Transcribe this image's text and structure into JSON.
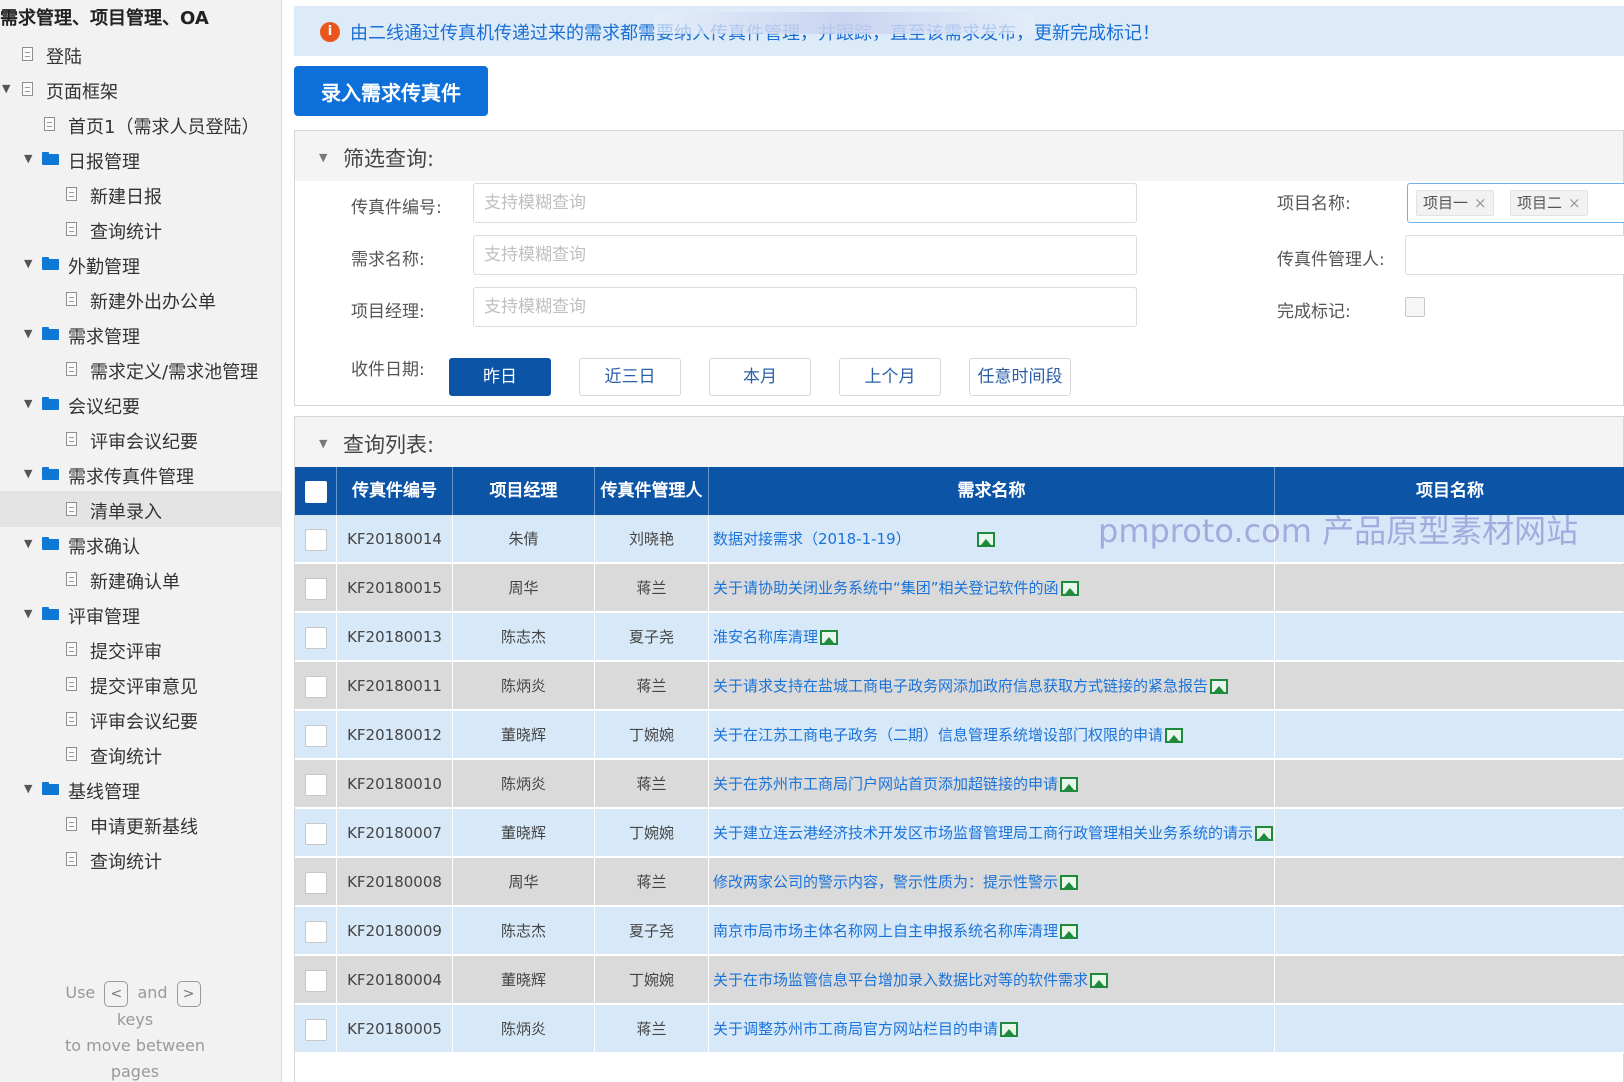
{
  "app": {
    "title": "需求管理、项目管理、OA"
  },
  "sidebar": {
    "items": [
      {
        "label": "登陆",
        "level": 0,
        "type": "page",
        "caret": false,
        "selected": false
      },
      {
        "label": "页面框架",
        "level": 0,
        "type": "page",
        "caret": true,
        "selected": false
      },
      {
        "label": "首页1（需求人员登陆）",
        "level": 1,
        "type": "page",
        "caret": false,
        "selected": false
      },
      {
        "label": "日报管理",
        "level": 1,
        "type": "folder",
        "caret": true,
        "selected": false
      },
      {
        "label": "新建日报",
        "level": 2,
        "type": "page",
        "caret": false,
        "selected": false
      },
      {
        "label": "查询统计",
        "level": 2,
        "type": "page",
        "caret": false,
        "selected": false
      },
      {
        "label": "外勤管理",
        "level": 1,
        "type": "folder",
        "caret": true,
        "selected": false
      },
      {
        "label": "新建外出办公单",
        "level": 2,
        "type": "page",
        "caret": false,
        "selected": false
      },
      {
        "label": "需求管理",
        "level": 1,
        "type": "folder",
        "caret": true,
        "selected": false
      },
      {
        "label": "需求定义/需求池管理",
        "level": 2,
        "type": "page",
        "caret": false,
        "selected": false
      },
      {
        "label": "会议纪要",
        "level": 1,
        "type": "folder",
        "caret": true,
        "selected": false
      },
      {
        "label": "评审会议纪要",
        "level": 2,
        "type": "page",
        "caret": false,
        "selected": false
      },
      {
        "label": "需求传真件管理",
        "level": 1,
        "type": "folder",
        "caret": true,
        "selected": false
      },
      {
        "label": "清单录入",
        "level": 2,
        "type": "page",
        "caret": false,
        "selected": true
      },
      {
        "label": "需求确认",
        "level": 1,
        "type": "folder",
        "caret": true,
        "selected": false
      },
      {
        "label": "新建确认单",
        "level": 2,
        "type": "page",
        "caret": false,
        "selected": false
      },
      {
        "label": "评审管理",
        "level": 1,
        "type": "folder",
        "caret": true,
        "selected": false
      },
      {
        "label": "提交评审",
        "level": 2,
        "type": "page",
        "caret": false,
        "selected": false
      },
      {
        "label": "提交评审意见",
        "level": 2,
        "type": "page",
        "caret": false,
        "selected": false
      },
      {
        "label": "评审会议纪要",
        "level": 2,
        "type": "page",
        "caret": false,
        "selected": false
      },
      {
        "label": "查询统计",
        "level": 2,
        "type": "page",
        "caret": false,
        "selected": false
      },
      {
        "label": "基线管理",
        "level": 1,
        "type": "folder",
        "caret": true,
        "selected": false
      },
      {
        "label": "申请更新基线",
        "level": 2,
        "type": "page",
        "caret": false,
        "selected": false
      },
      {
        "label": "查询统计",
        "level": 2,
        "type": "page",
        "caret": false,
        "selected": false
      }
    ],
    "hint": {
      "use": "Use",
      "and": "and",
      "keys": "keys",
      "move": "to move between",
      "pages": "pages",
      "prev_key": "<",
      "next_key": ">"
    }
  },
  "notice": {
    "text": "由二线通过传真机传递过来的需求都需要纳入传真件管理，并跟踪，直至该需求发布，更新完成标记！",
    "icon": "info-icon"
  },
  "actions": {
    "add_fax_label": "录入需求传真件"
  },
  "filter": {
    "title": "筛选查询:",
    "fax_no_label": "传真件编号:",
    "fax_no_placeholder": "支持模糊查询",
    "req_name_label": "需求名称:",
    "req_name_placeholder": "支持模糊查询",
    "pm_label": "项目经理:",
    "pm_placeholder": "支持模糊查询",
    "project_label": "项目名称:",
    "project_tags": [
      "项目一",
      "项目二"
    ],
    "fax_manager_label": "传真件管理人:",
    "done_label": "完成标记:",
    "date_label": "收件日期:",
    "date_buttons": [
      {
        "label": "昨日",
        "active": true
      },
      {
        "label": "近三日",
        "active": false
      },
      {
        "label": "本月",
        "active": false
      },
      {
        "label": "上个月",
        "active": false
      },
      {
        "label": "任意时间段",
        "active": false
      }
    ]
  },
  "list": {
    "title": "查询列表:",
    "columns": [
      "传真件编号",
      "项目经理",
      "传真件管理人",
      "需求名称",
      "项目名称"
    ],
    "rows": [
      {
        "id": "KF20180014",
        "pm": "朱倩",
        "manager": "刘晓艳",
        "name": "数据对接需求（2018-1-19）",
        "project": ""
      },
      {
        "id": "KF20180015",
        "pm": "周华",
        "manager": "蒋兰",
        "name": "关于请协助关闭业务系统中“集团”相关登记软件的函",
        "project": ""
      },
      {
        "id": "KF20180013",
        "pm": "陈志杰",
        "manager": "夏子尧",
        "name": "淮安名称库清理",
        "project": ""
      },
      {
        "id": "KF20180011",
        "pm": "陈炳炎",
        "manager": "蒋兰",
        "name": "关于请求支持在盐城工商电子政务网添加政府信息获取方式链接的紧急报告",
        "project": ""
      },
      {
        "id": "KF20180012",
        "pm": "董晓辉",
        "manager": "丁婉婉",
        "name": "关于在江苏工商电子政务（二期）信息管理系统增设部门权限的申请",
        "project": ""
      },
      {
        "id": "KF20180010",
        "pm": "陈炳炎",
        "manager": "蒋兰",
        "name": "关于在苏州市工商局门户网站首页添加超链接的申请",
        "project": ""
      },
      {
        "id": "KF20180007",
        "pm": "董晓辉",
        "manager": "丁婉婉",
        "name": "关于建立连云港经济技术开发区市场监督管理局工商行政管理相关业务系统的请示",
        "project": ""
      },
      {
        "id": "KF20180008",
        "pm": "周华",
        "manager": "蒋兰",
        "name": "修改两家公司的警示内容，警示性质为：提示性警示",
        "project": ""
      },
      {
        "id": "KF20180009",
        "pm": "陈志杰",
        "manager": "夏子尧",
        "name": "南京市局市场主体名称网上自主申报系统名称库清理",
        "project": ""
      },
      {
        "id": "KF20180004",
        "pm": "董晓辉",
        "manager": "丁婉婉",
        "name": "关于在市场监管信息平台增加录入数据比对等的软件需求",
        "project": ""
      },
      {
        "id": "KF20180005",
        "pm": "陈炳炎",
        "manager": "蒋兰",
        "name": "关于调整苏州市工商局官方网站栏目的申请",
        "project": ""
      }
    ]
  },
  "watermark": "pmproto.com 产品原型素材网站",
  "colors": {
    "primary": "#0c70d8",
    "header": "#0b54a6",
    "link": "#1a73d9",
    "row_even": "#d7e9f8",
    "row_odd": "#dadada",
    "notice_bg": "#dcebf7"
  }
}
